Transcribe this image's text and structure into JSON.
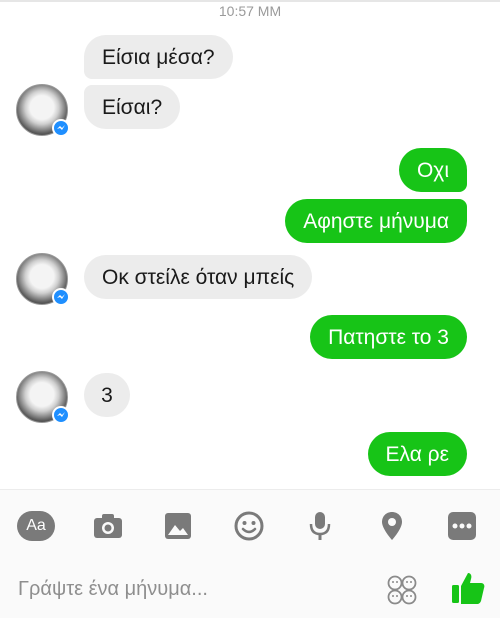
{
  "header": {
    "time": "10:57 MM"
  },
  "messages": [
    {
      "side": "in",
      "text": "Είσια μέσα?"
    },
    {
      "side": "in",
      "text": "Είσαι?"
    },
    {
      "side": "out",
      "text": "Οχι"
    },
    {
      "side": "out",
      "text": "Αφηστε μήνυμα"
    },
    {
      "side": "in",
      "text": "Οκ στείλε όταν μπείς"
    },
    {
      "side": "out",
      "text": "Πατηστε το 3"
    },
    {
      "side": "in",
      "text": "3"
    },
    {
      "side": "out",
      "text": "Ελα ρε"
    }
  ],
  "composer": {
    "placeholder": "Γράψτε ένα μήνυμα...",
    "tools": [
      "text-style-icon",
      "camera-icon",
      "gallery-icon",
      "emoji-icon",
      "microphone-icon",
      "location-icon",
      "more-icon"
    ],
    "aa_label": "Aa"
  },
  "colors": {
    "outgoing": "#17c417",
    "incoming": "#ececec",
    "accent": "#1f8fff"
  }
}
